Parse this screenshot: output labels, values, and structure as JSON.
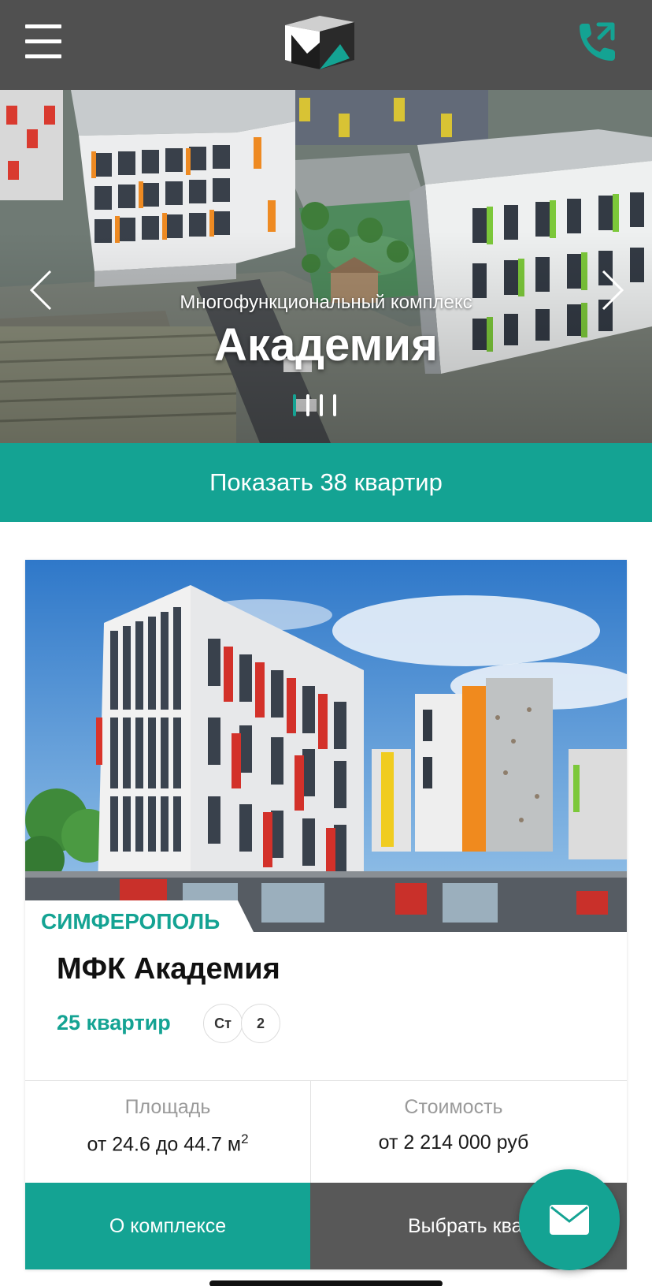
{
  "header": {
    "menu_icon": "hamburger-icon",
    "logo": "brand-logo",
    "phone_icon": "phone-icon"
  },
  "hero": {
    "subtitle": "Многофункциональный комплекс",
    "title": "Академия",
    "slides_count": 4,
    "active_slide": 1,
    "prev_icon": "chevron-left-icon",
    "next_icon": "chevron-right-icon"
  },
  "show_button": {
    "label": "Показать 38 квартир"
  },
  "card": {
    "title": "МФК Академия",
    "apartments": "25 квартир",
    "room_types": [
      "Ст",
      "2"
    ],
    "area": {
      "label": "Площадь",
      "value": "от 24.6 до 44.7 м",
      "unit_sup": "2"
    },
    "price": {
      "label": "Стоимость",
      "value": "от 2 214 000 руб"
    },
    "about_button": "О комплексе",
    "select_button": "Выбрать квартиру",
    "image_caption": "СИМФЕРОПОЛЬ"
  },
  "fab": {
    "icon": "mail-icon"
  },
  "colors": {
    "accent": "#14a393",
    "header": "#505050",
    "dark_button": "#585858"
  }
}
